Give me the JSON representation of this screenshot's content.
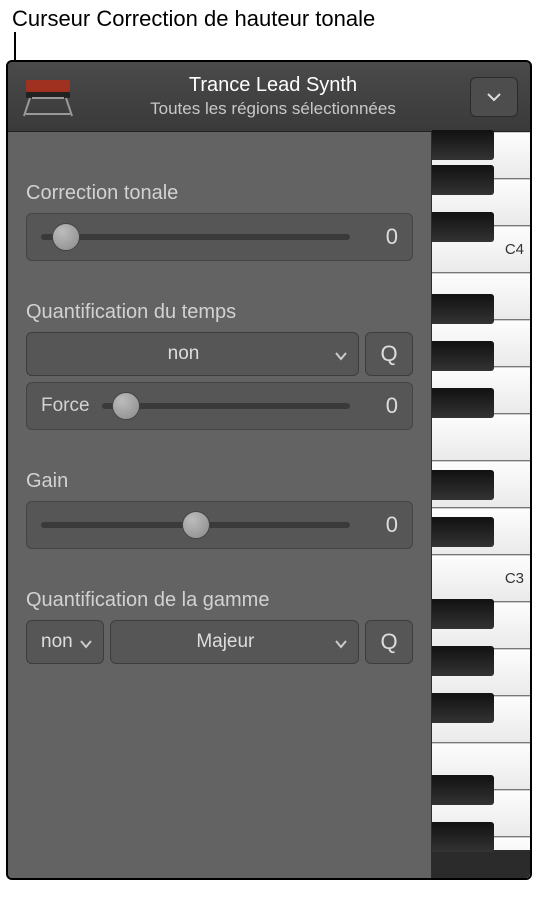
{
  "callout": {
    "text": "Curseur Correction de hauteur tonale"
  },
  "header": {
    "title": "Trance Lead Synth",
    "subtitle": "Toutes les régions sélectionnées"
  },
  "pitch": {
    "label": "Correction tonale",
    "value": "0",
    "slider_percent": 8
  },
  "time_quantize": {
    "label": "Quantification du temps",
    "select_value": "non",
    "q_button": "Q",
    "strength_label": "Force",
    "strength_value": "0",
    "strength_slider_percent": 10
  },
  "gain": {
    "label": "Gain",
    "value": "0",
    "slider_percent": 50
  },
  "scale_quantize": {
    "label": "Quantification de la gamme",
    "root_value": "non",
    "mode_value": "Majeur",
    "q_button": "Q"
  },
  "keyboard": {
    "labels": {
      "c4": "C4",
      "c3": "C3"
    }
  }
}
